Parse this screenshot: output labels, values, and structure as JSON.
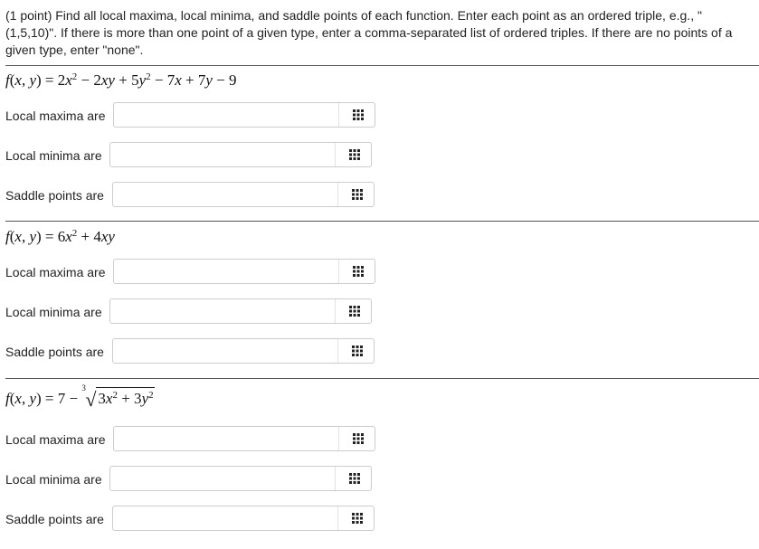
{
  "intro": {
    "text": "(1 point) Find all local maxima, local minima, and saddle points of each function. Enter each point as an ordered triple, e.g., \"(1,5,10)\". If there is more than one point of a given type, enter a comma-separated list of ordered triples. If there are no points of a given type, enter \"none\"."
  },
  "labels": {
    "local_maxima": "Local maxima are",
    "local_minima": "Local minima are",
    "saddle_points": "Saddle points are"
  },
  "problems": [
    {
      "function": "f(x, y) = 2x² − 2xy + 5y² − 7x + 7y − 9",
      "answers": {
        "local_maxima": "",
        "local_minima": "",
        "saddle_points": ""
      }
    },
    {
      "function": "f(x, y) = 6x² + 4xy",
      "answers": {
        "local_maxima": "",
        "local_minima": "",
        "saddle_points": ""
      }
    },
    {
      "function": "f(x, y) = 7 − ∛(3x² + 3y²)",
      "answers": {
        "local_maxima": "",
        "local_minima": "",
        "saddle_points": ""
      }
    }
  ]
}
